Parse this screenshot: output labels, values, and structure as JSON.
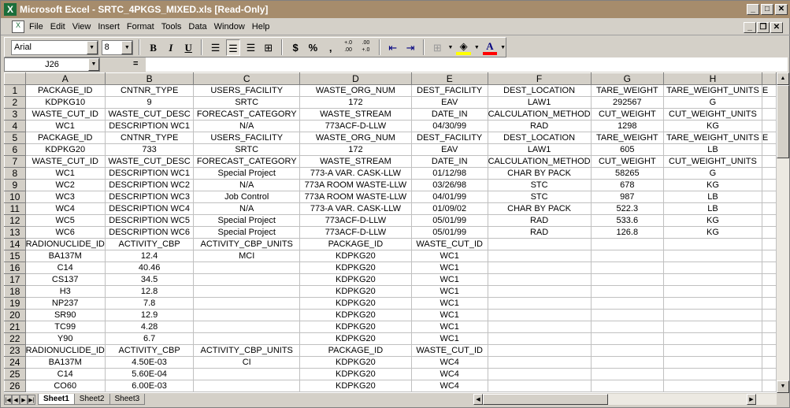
{
  "title": "Microsoft Excel - SRTC_4PKGS_MIXED.xls  [Read-Only]",
  "menu": [
    "File",
    "Edit",
    "View",
    "Insert",
    "Format",
    "Tools",
    "Data",
    "Window",
    "Help"
  ],
  "toolbar": {
    "font": "Arial",
    "size": "8",
    "bold": "B",
    "italic": "I",
    "underline": "U",
    "currency": "$",
    "percent": "%",
    "comma": ",",
    "inc_dec": "+.0\n.00",
    "dec_dec": ".00\n+.0",
    "font_color_label": "A"
  },
  "colors": {
    "fill": "#ffff00",
    "font": "#ff0000",
    "title": "#a68c6c"
  },
  "namebox": "J26",
  "formula_eq": "=",
  "columns": [
    "A",
    "B",
    "C",
    "D",
    "E",
    "F",
    "G",
    "H",
    ""
  ],
  "rows": [
    [
      "PACKAGE_ID",
      "CNTNR_TYPE",
      "USERS_FACILITY",
      "WASTE_ORG_NUM",
      "DEST_FACILITY",
      "DEST_LOCATION",
      "TARE_WEIGHT",
      "TARE_WEIGHT_UNITS",
      "E"
    ],
    [
      "KDPKG10",
      "9",
      "SRTC",
      "172",
      "EAV",
      "LAW1",
      "292567",
      "G",
      ""
    ],
    [
      "WASTE_CUT_ID",
      "WASTE_CUT_DESC",
      "FORECAST_CATEGORY",
      "WASTE_STREAM",
      "DATE_IN",
      "CALCULATION_METHOD",
      "CUT_WEIGHT",
      "CUT_WEIGHT_UNITS",
      ""
    ],
    [
      "WC1",
      "DESCRIPTION WC1",
      "N/A",
      "773ACF-D-LLW",
      "04/30/99",
      "RAD",
      "1298",
      "KG",
      ""
    ],
    [
      "PACKAGE_ID",
      "CNTNR_TYPE",
      "USERS_FACILITY",
      "WASTE_ORG_NUM",
      "DEST_FACILITY",
      "DEST_LOCATION",
      "TARE_WEIGHT",
      "TARE_WEIGHT_UNITS",
      "E"
    ],
    [
      "KDPKG20",
      "733",
      "SRTC",
      "172",
      "EAV",
      "LAW1",
      "605",
      "LB",
      ""
    ],
    [
      "WASTE_CUT_ID",
      "WASTE_CUT_DESC",
      "FORECAST_CATEGORY",
      "WASTE_STREAM",
      "DATE_IN",
      "CALCULATION_METHOD",
      "CUT_WEIGHT",
      "CUT_WEIGHT_UNITS",
      ""
    ],
    [
      "WC1",
      "DESCRIPTION WC1",
      "Special Project",
      "773-A VAR. CASK-LLW",
      "01/12/98",
      "CHAR BY PACK",
      "58265",
      "G",
      ""
    ],
    [
      "WC2",
      "DESCRIPTION WC2",
      "N/A",
      "773A ROOM WASTE-LLW",
      "03/26/98",
      "STC",
      "678",
      "KG",
      ""
    ],
    [
      "WC3",
      "DESCRIPTION WC3",
      "Job Control",
      "773A ROOM WASTE-LLW",
      "04/01/99",
      "STC",
      "987",
      "LB",
      ""
    ],
    [
      "WC4",
      "DESCRIPTION WC4",
      "N/A",
      "773-A VAR. CASK-LLW",
      "01/09/02",
      "CHAR BY PACK",
      "522.3",
      "LB",
      ""
    ],
    [
      "WC5",
      "DESCRIPTION WC5",
      "Special Project",
      "773ACF-D-LLW",
      "05/01/99",
      "RAD",
      "533.6",
      "KG",
      ""
    ],
    [
      "WC6",
      "DESCRIPTION WC6",
      "Special Project",
      "773ACF-D-LLW",
      "05/01/99",
      "RAD",
      "126.8",
      "KG",
      ""
    ],
    [
      "RADIONUCLIDE_ID",
      "ACTIVITY_CBP",
      "ACTIVITY_CBP_UNITS",
      "PACKAGE_ID",
      "WASTE_CUT_ID",
      "",
      "",
      "",
      ""
    ],
    [
      "BA137M",
      "12.4",
      "MCI",
      "KDPKG20",
      "WC1",
      "",
      "",
      "",
      ""
    ],
    [
      "C14",
      "40.46",
      "",
      "KDPKG20",
      "WC1",
      "",
      "",
      "",
      ""
    ],
    [
      "CS137",
      "34.5",
      "",
      "KDPKG20",
      "WC1",
      "",
      "",
      "",
      ""
    ],
    [
      "H3",
      "12.8",
      "",
      "KDPKG20",
      "WC1",
      "",
      "",
      "",
      ""
    ],
    [
      "NP237",
      "7.8",
      "",
      "KDPKG20",
      "WC1",
      "",
      "",
      "",
      ""
    ],
    [
      "SR90",
      "12.9",
      "",
      "KDPKG20",
      "WC1",
      "",
      "",
      "",
      ""
    ],
    [
      "TC99",
      "4.28",
      "",
      "KDPKG20",
      "WC1",
      "",
      "",
      "",
      ""
    ],
    [
      "Y90",
      "6.7",
      "",
      "KDPKG20",
      "WC1",
      "",
      "",
      "",
      ""
    ],
    [
      "RADIONUCLIDE_ID",
      "ACTIVITY_CBP",
      "ACTIVITY_CBP_UNITS",
      "PACKAGE_ID",
      "WASTE_CUT_ID",
      "",
      "",
      "",
      ""
    ],
    [
      "BA137M",
      "4.50E-03",
      "CI",
      "KDPKG20",
      "WC4",
      "",
      "",
      "",
      ""
    ],
    [
      "C14",
      "5.60E-04",
      "",
      "KDPKG20",
      "WC4",
      "",
      "",
      "",
      ""
    ],
    [
      "CO60",
      "6.00E-03",
      "",
      "KDPKG20",
      "WC4",
      "",
      "",
      "",
      ""
    ]
  ],
  "sheets": [
    "Sheet1",
    "Sheet2",
    "Sheet3"
  ],
  "active_sheet": "Sheet1"
}
